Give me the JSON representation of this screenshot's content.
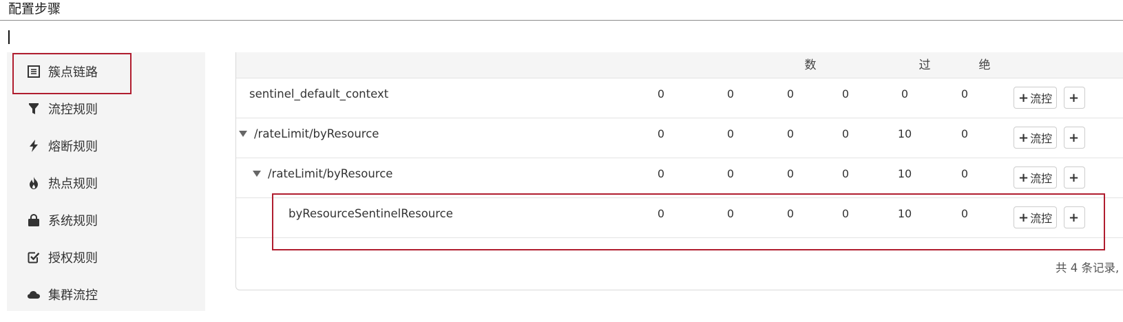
{
  "doc": {
    "title": "配置步骤"
  },
  "sidebar": {
    "items": [
      {
        "label": "簇点链路"
      },
      {
        "label": "流控规则"
      },
      {
        "label": "熔断规则"
      },
      {
        "label": "热点规则"
      },
      {
        "label": "系统规则"
      },
      {
        "label": "授权规则"
      },
      {
        "label": "集群流控"
      }
    ]
  },
  "table": {
    "header_fragments": [
      "数",
      "过",
      "绝"
    ],
    "rows": [
      {
        "name": "sentinel_default_context",
        "values": [
          "0",
          "0",
          "0",
          "0",
          "0",
          "0"
        ],
        "button_label": "流控",
        "expandable": false
      },
      {
        "name": "/rateLimit/byResource",
        "values": [
          "0",
          "0",
          "0",
          "0",
          "10",
          "0"
        ],
        "button_label": "流控",
        "expandable": true
      },
      {
        "name": "/rateLimit/byResource",
        "values": [
          "0",
          "0",
          "0",
          "0",
          "10",
          "0"
        ],
        "button_label": "流控",
        "expandable": true
      },
      {
        "name": "byResourceSentinelResource",
        "values": [
          "0",
          "0",
          "0",
          "0",
          "10",
          "0"
        ],
        "button_label": "流控",
        "expandable": false
      }
    ],
    "footer": "共 4 条记录,"
  },
  "colors": {
    "highlight": "#b01c2e",
    "header_bg": "#f5f5f5",
    "sidebar_bg": "#f4f4f4"
  }
}
